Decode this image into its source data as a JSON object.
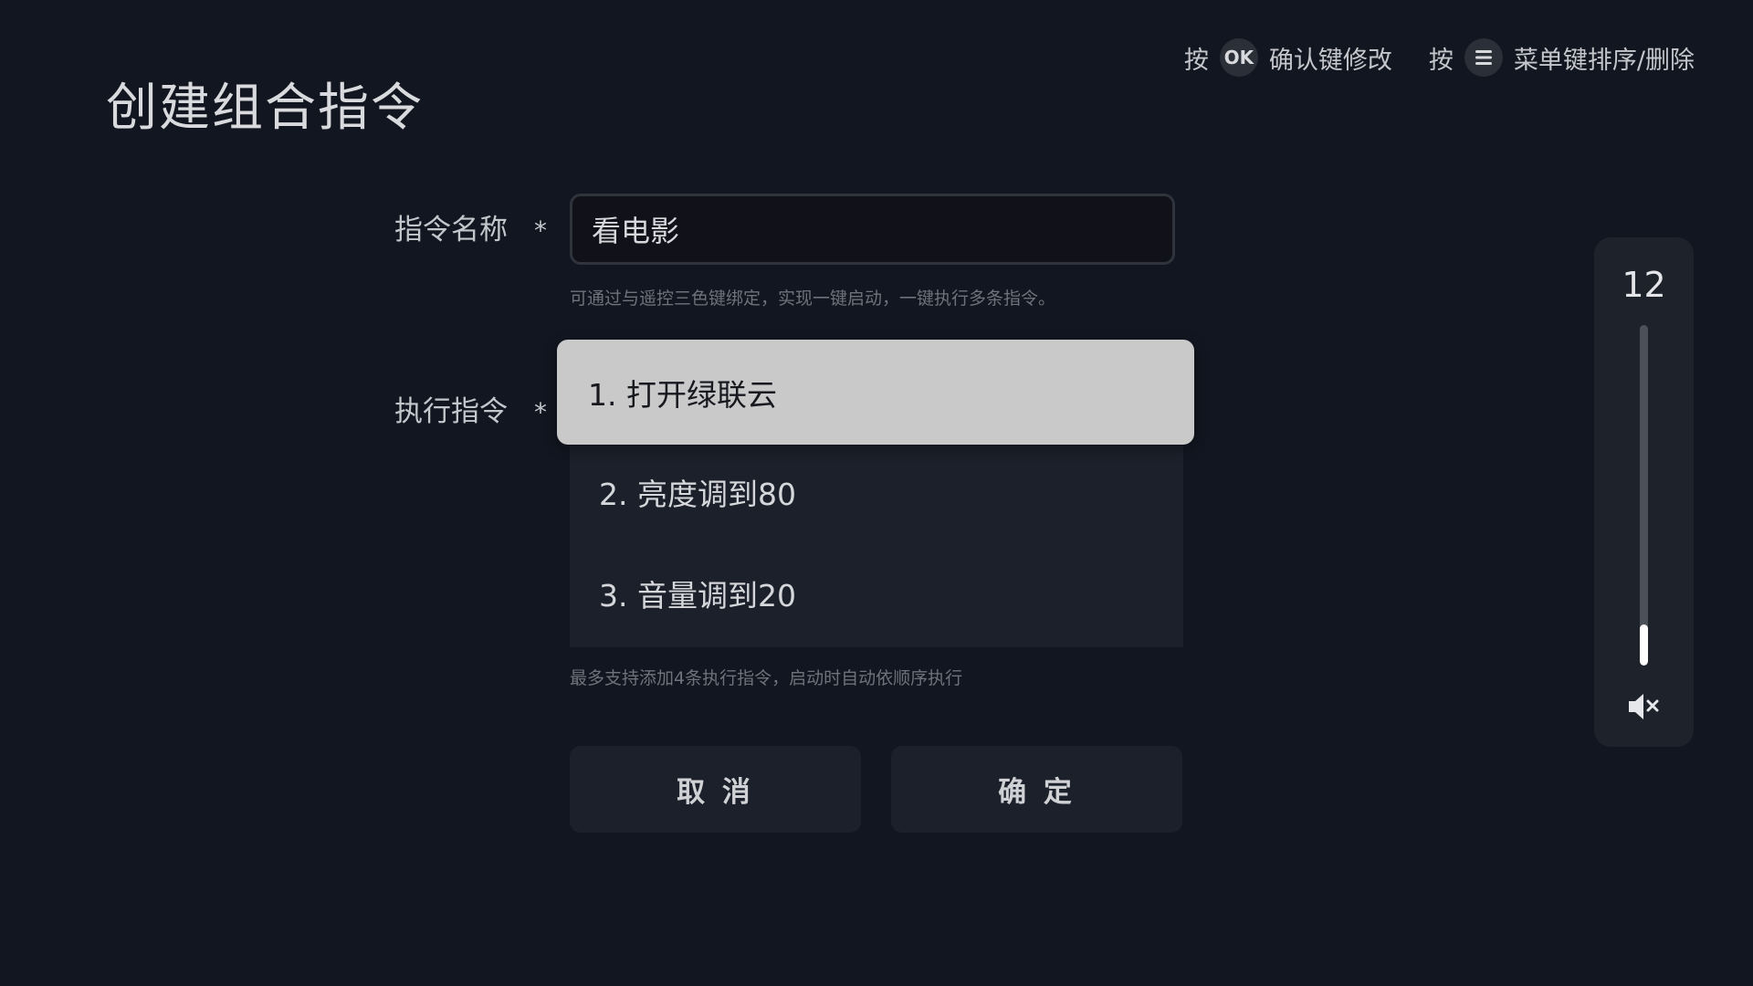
{
  "page": {
    "title": "创建组合指令"
  },
  "hints": {
    "ok": {
      "prefix": "按",
      "key": "OK",
      "text": "确认键修改"
    },
    "menu": {
      "prefix": "按",
      "key_icon": "menu-icon",
      "text": "菜单键排序/删除"
    }
  },
  "form": {
    "required_mark": "*",
    "name_label": "指令名称",
    "name_value": "看电影",
    "name_hint": "可通过与遥控三色键绑定，实现一键启动，一键执行多条指令。",
    "commands_label": "执行指令",
    "commands": [
      {
        "label": "1. 打开绿联云",
        "focused": true
      },
      {
        "label": "2. 亮度调到80",
        "focused": false
      },
      {
        "label": "3. 音量调到20",
        "focused": false
      }
    ],
    "commands_hint": "最多支持添加4条执行指令，启动时自动依顺序执行"
  },
  "buttons": {
    "cancel": "取 消",
    "confirm": "确 定"
  },
  "volume": {
    "value": "12",
    "level": 0.12,
    "icon": "mute-icon"
  },
  "colors": {
    "background": "#121620",
    "focused_item": "#c9c9ca",
    "item_bg": "#1c202a"
  }
}
